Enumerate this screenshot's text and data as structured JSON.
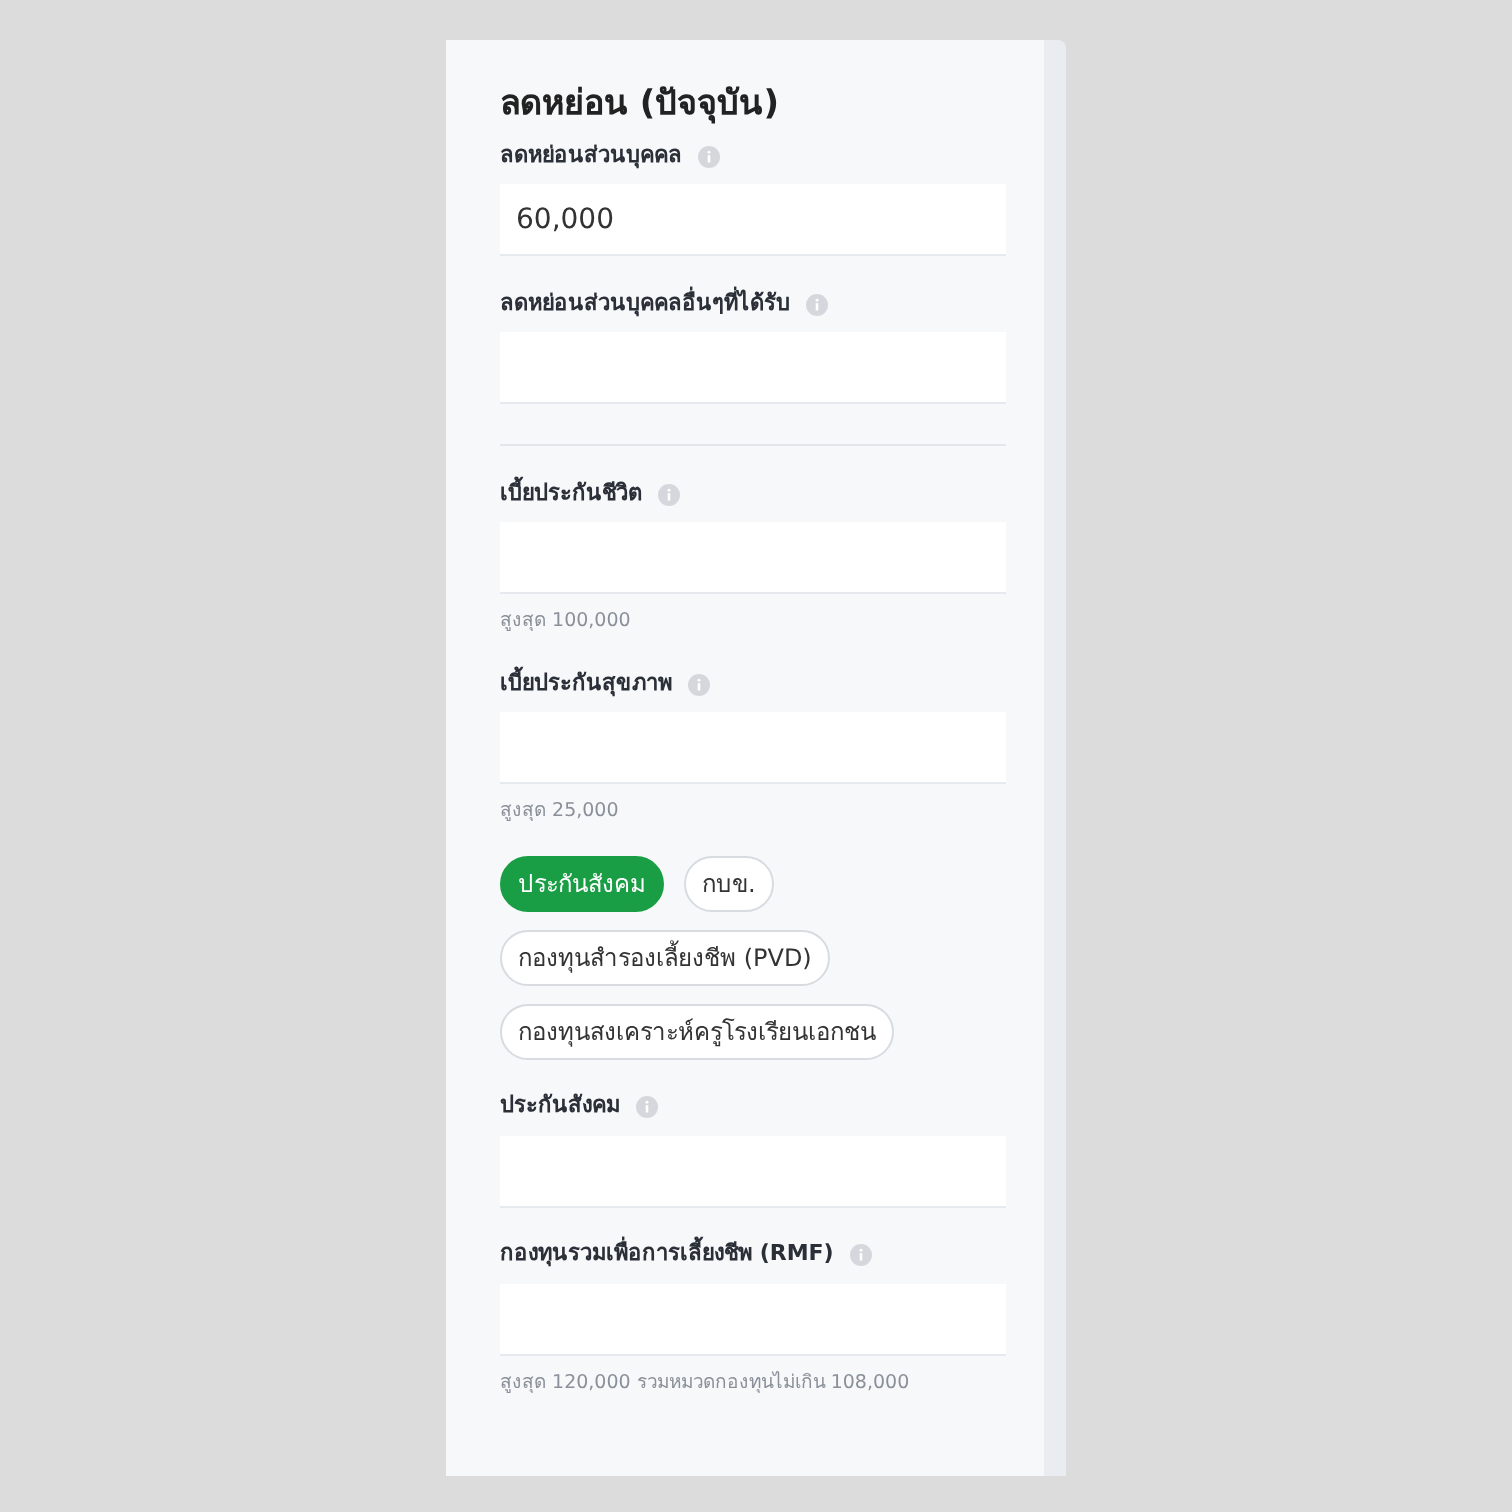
{
  "title": "ลดหย่อน (ปัจจุบัน)",
  "items": [
    {
      "kind": "field",
      "label": "ลดหย่อนส่วนบุคคล",
      "value": "60,000"
    },
    {
      "kind": "field",
      "label": "ลดหย่อนส่วนบุคคลอื่นๆที่ได้รับ",
      "divider_after": true
    },
    {
      "kind": "field",
      "label": "เบี้ยประกันชีวิต",
      "hint": "สูงสุด 100,000"
    },
    {
      "kind": "field",
      "label": "เบี้ยประกันสุขภาพ",
      "hint": "สูงสุด 25,000"
    },
    {
      "kind": "chips",
      "chips": [
        {
          "label": "ประกันสังคม",
          "selected": true
        },
        {
          "label": "กบข.",
          "selected": false
        },
        {
          "label": "กองทุนสำรองเลี้ยงชีพ (PVD)",
          "selected": false
        },
        {
          "label": "กองทุนสงเคราะห์ครูโรงเรียนเอกชน",
          "selected": false
        }
      ]
    },
    {
      "kind": "field",
      "label": "ประกันสังคม"
    },
    {
      "kind": "field",
      "label": "กองทุนรวมเพื่อการเลี้ยงชีพ (RMF)",
      "hint": "สูงสุด 120,000 รวมหมวดกองทุนไม่เกิน 108,000"
    }
  ]
}
